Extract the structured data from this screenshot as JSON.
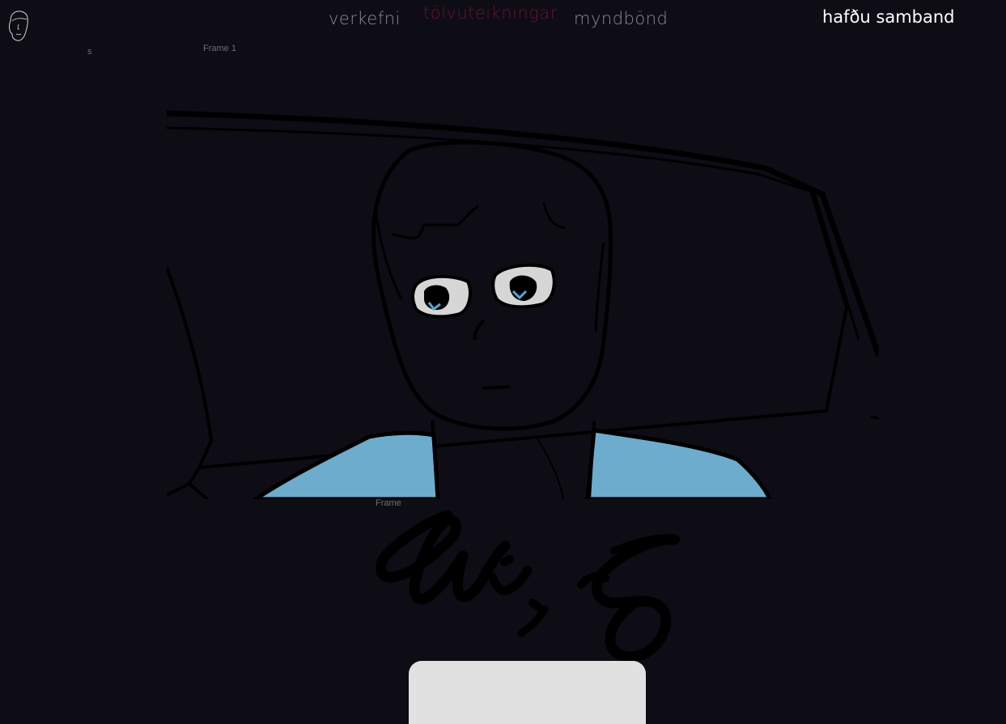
{
  "header": {
    "logo_icon": "face-outline-icon",
    "nav": [
      {
        "label": "verkefni",
        "color": "#8a8a90"
      },
      {
        "label": "tölvuteikningar",
        "color": "#6a1030"
      },
      {
        "label": "myndbönd",
        "color": "#8a8a90"
      }
    ],
    "contact_label": "hafðu samband",
    "contact_color": "#ffffff"
  },
  "labels": {
    "s": "s",
    "frame_1": "Frame 1",
    "frame": "Frame"
  },
  "artwork": {
    "subject": "portrait-drawing",
    "colors": {
      "background": "#0e0d15",
      "shirt": "#6eacce",
      "eye_white": "#d6d6d6",
      "iris": "#5aa6d4",
      "line": "#000000"
    }
  },
  "signature": {
    "type": "handwritten-signature",
    "color": "#000000"
  },
  "card": {
    "color": "#e1e1e1"
  }
}
